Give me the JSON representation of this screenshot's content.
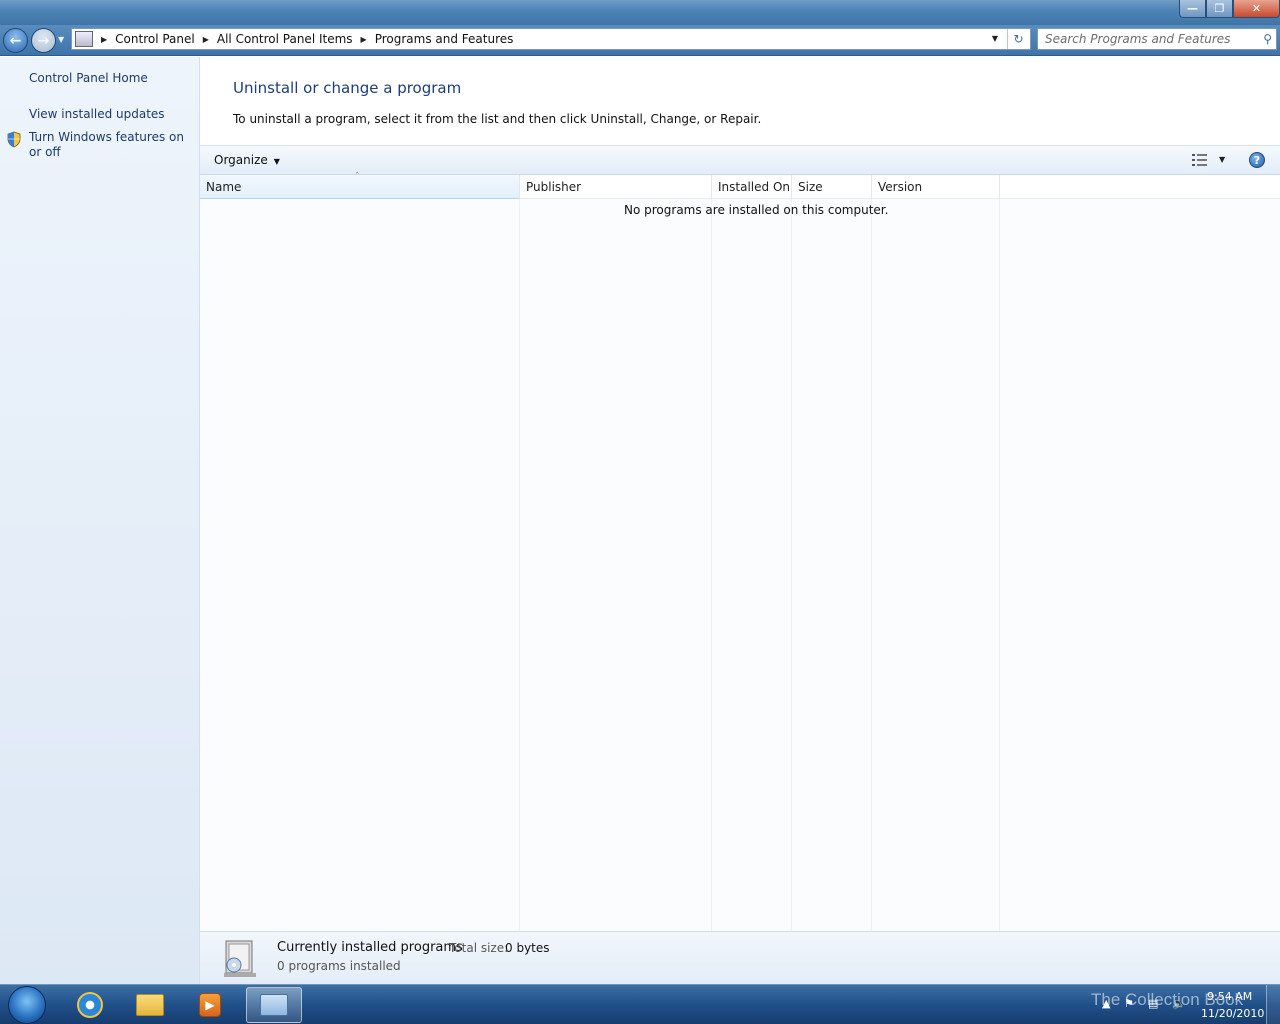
{
  "window": {
    "minimize_glyph": "—",
    "restore_glyph": "❐",
    "close_glyph": "✕"
  },
  "address": {
    "crumbs": [
      "Control Panel",
      "All Control Panel Items",
      "Programs and Features"
    ],
    "search_placeholder": "Search Programs and Features"
  },
  "sidebar": {
    "items": [
      {
        "label": "Control Panel Home"
      },
      {
        "label": "View installed updates"
      },
      {
        "label": "Turn Windows features on or off"
      }
    ]
  },
  "main": {
    "heading": "Uninstall or change a program",
    "intro": "To uninstall a program, select it from the list and then click Uninstall, Change, or Repair.",
    "organize_label": "Organize",
    "columns": [
      "Name",
      "Publisher",
      "Installed On",
      "Size",
      "Version"
    ],
    "empty_message": "No programs are installed on this computer."
  },
  "details": {
    "title": "Currently installed programs",
    "total_size_label": "Total size:",
    "total_size_value": "0 bytes",
    "count": "0 programs installed"
  },
  "taskbar": {
    "time": "9:54 AM",
    "date": "11/20/2010",
    "watermark": "The Collection Book"
  }
}
